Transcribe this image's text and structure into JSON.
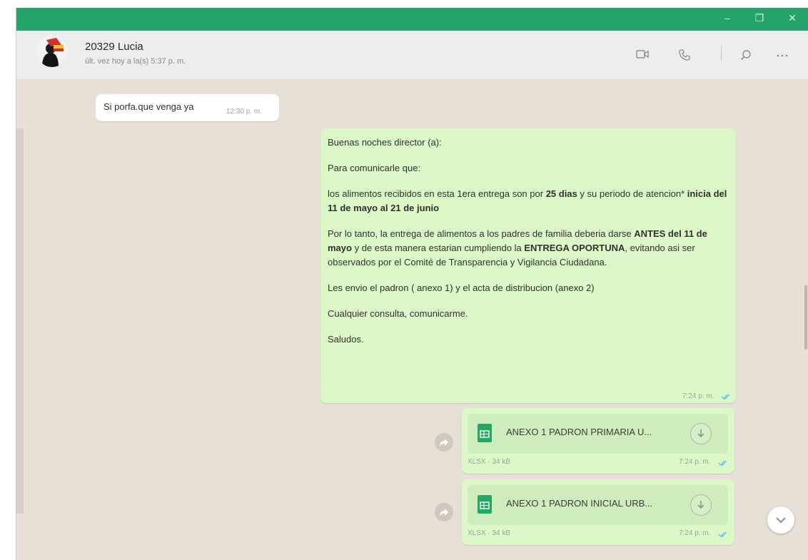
{
  "window": {
    "controls": [
      "–",
      "❐",
      "✕"
    ]
  },
  "header": {
    "contact_name": "20329 Lucia",
    "last_seen": "últ. vez hoy a la(s) 5:37 p. m."
  },
  "messages": [
    {
      "type": "incoming",
      "text": "Si porfa.que venga ya",
      "time": "12:30 p. m."
    },
    {
      "type": "outgoing",
      "lines": {
        "l1": "Buenas noches director (a):",
        "l2": " Para comunicarle que:",
        "l3a": "los alimentos recibidos en esta 1era entrega son por ",
        "l3b": "25 dias",
        "l3c": " y su periodo de atencion* ",
        "l3d": "inicia del 11 de mayo al 21 de junio",
        "l4a": "Por lo tanto, la entrega de alimentos a los padres de familia deberia darse ",
        "l4b": "ANTES del 11 de mayo",
        "l4c": " y de esta manera estarian cumpliendo la ",
        "l4d": "ENTREGA OPORTUNA",
        "l4e": ", evitando asi  ser observados por el Comité de Transparencia y Vigilancia Ciudadana.",
        "l5": "Les envio el padron ( anexo 1) y el acta de distribucion (anexo 2)",
        "l6": "Cualquier consulta, comunicarme.",
        "l7": "Saludos."
      },
      "time": "7:24 p. m."
    },
    {
      "type": "document",
      "name": "ANEXO 1 PADRON PRIMARIA U...",
      "meta": "XLSX · 34 kB",
      "time": "7:24 p. m."
    },
    {
      "type": "document",
      "name": "ANEXO 1 PADRON INICIAL URB...",
      "meta": "XLSX · 34 kB",
      "time": "7:24 p. m."
    }
  ],
  "colors": {
    "titlebar": "#25a46a",
    "outgoing_bubble": "#dcf8c6",
    "incoming_bubble": "#ffffff",
    "chat_background": "#e7e0d6",
    "ticks": "#4fc3f7"
  },
  "icons": {
    "header": [
      "video-call-icon",
      "voice-call-icon",
      "search-icon",
      "menu-icon"
    ],
    "other": [
      "forward-icon",
      "download-icon",
      "scroll-down-icon",
      "xlsx-file-icon",
      "read-ticks-icon"
    ]
  }
}
